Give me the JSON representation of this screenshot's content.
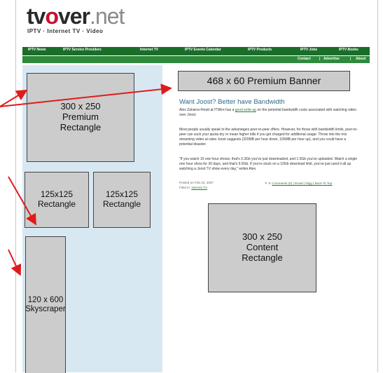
{
  "site": {
    "logo_tv": "tv",
    "logo_o": "o",
    "logo_ver": "ver",
    "logo_net": ".net",
    "tagline": "IPTV  ·  Internet TV  ·  Video"
  },
  "nav": [
    "IPTV News",
    "IPTV Service Providers",
    "Internet TV",
    "IPTV Events Calendar",
    "IPTV Products",
    "IPTV Jobs",
    "IPTV Books"
  ],
  "subnav": [
    "Contact",
    "Advertise",
    "About"
  ],
  "ads": {
    "banner": "468 x 60 Premium Banner",
    "premium_rect": "300 x 250\nPremium\nRectangle",
    "rect_125_a": "125x125\nRectangle",
    "rect_125_b": "125x125\nRectangle",
    "skyscraper": "120 x 600\nSkyscraper",
    "content_rect": "300 x 250\nContent\nRectangle"
  },
  "post": {
    "title": "Want Joost? Better have Bandwidth",
    "p1_a": "Alex Zaharov-Reutt at ITWire has a ",
    "p1_link": "good write-up",
    "p1_b": " on the potential bandwidth costs associated with watching video over Joost.",
    "p2": "Most people usually speak to the advantages peer-to-peer offers. However, for those with bandwidth limits, peer-to-peer can suck your quota dry or mean higher bills if you get charged for additional usage. Throw into the mix streaming video at rates Joost suggests (320MB per hour down, 105MB per hour up), and you could have a potential disaster.",
    "p3": "\"If you watch 10 one hour shows, that's 3.3Gb you've just downloaded, and 1.5Gb you've uploaded. Watch a single one hour show for 30 days, and that's 9.9Gb. If you're stuck on a 10Gb download limit, you've just used it all up watching a Joost TV show every day,\" writes Alex.",
    "posted": "Posted on Feb 22, 2007",
    "filed_label": "Filed in: ",
    "filed_link": "Internet TV",
    "actions": "Comments (0) | Email | Digg | Back To Top"
  }
}
